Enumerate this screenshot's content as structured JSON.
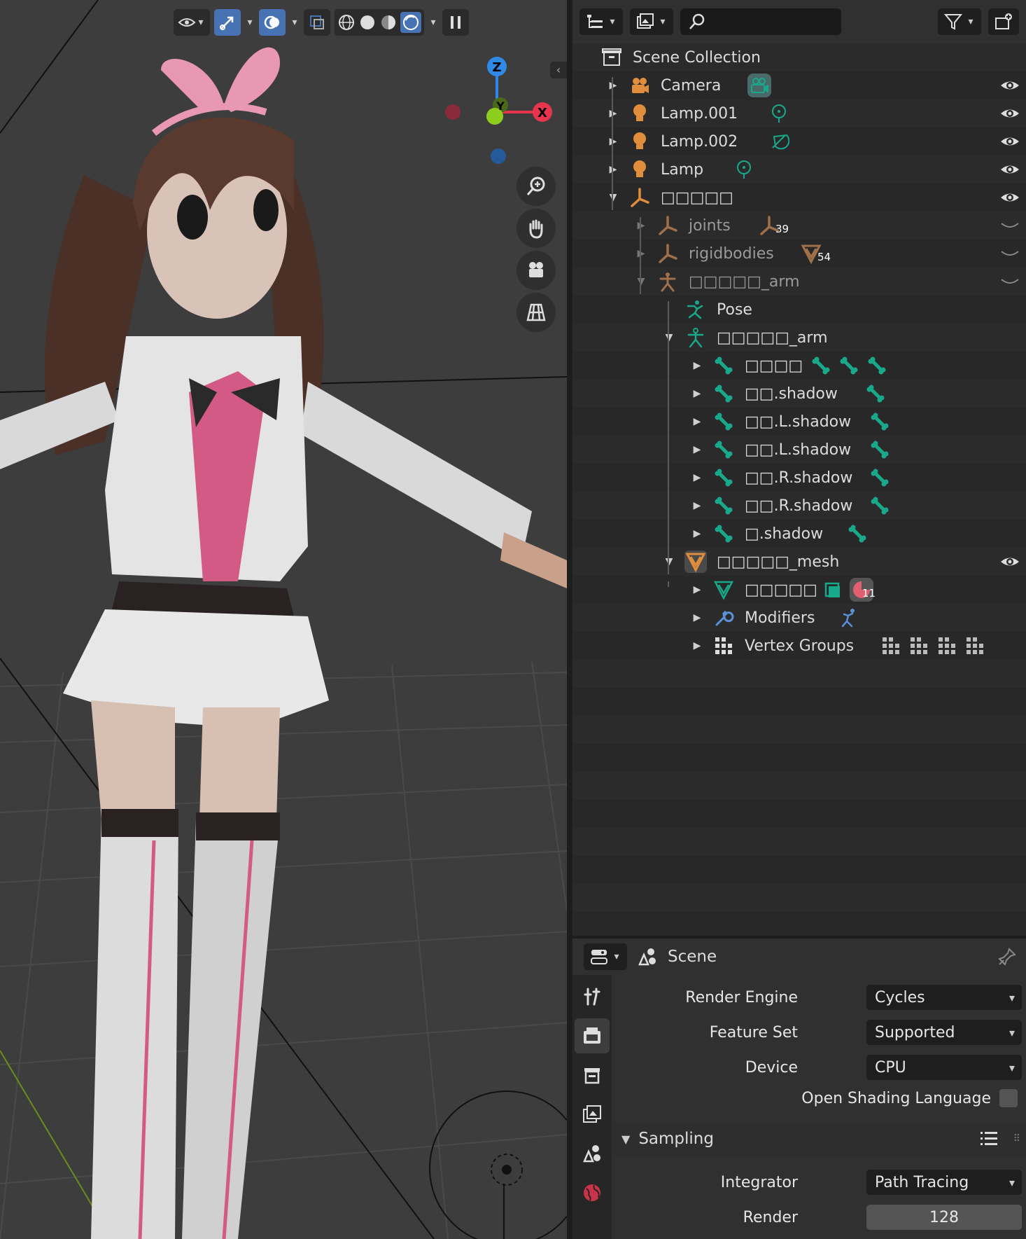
{
  "viewport": {
    "gizmo": {
      "x": "X",
      "y": "Y",
      "z": "Z"
    }
  },
  "outliner": {
    "search_placeholder": "",
    "rows": [
      {
        "label": "Scene Collection"
      },
      {
        "label": "Camera"
      },
      {
        "label": "Lamp.001"
      },
      {
        "label": "Lamp.002"
      },
      {
        "label": "Lamp"
      },
      {
        "label": "□□□□□"
      },
      {
        "label": "joints",
        "badge": "39"
      },
      {
        "label": "rigidbodies",
        "badge": "54"
      },
      {
        "label": "□□□□□_arm"
      },
      {
        "label": "Pose"
      },
      {
        "label": "□□□□□_arm"
      },
      {
        "label": "□□□□"
      },
      {
        "label": "□□.shadow"
      },
      {
        "label": "□□.L.shadow"
      },
      {
        "label": "□□.L.shadow"
      },
      {
        "label": "□□.R.shadow"
      },
      {
        "label": "□□.R.shadow"
      },
      {
        "label": "□.shadow"
      },
      {
        "label": "□□□□□_mesh"
      },
      {
        "label": "□□□□□",
        "badge": "11"
      },
      {
        "label": "Modifiers"
      },
      {
        "label": "Vertex Groups"
      }
    ]
  },
  "properties": {
    "context_title": "Scene",
    "render_engine": {
      "label": "Render Engine",
      "value": "Cycles"
    },
    "feature_set": {
      "label": "Feature Set",
      "value": "Supported"
    },
    "device": {
      "label": "Device",
      "value": "CPU"
    },
    "osl": {
      "label": "Open Shading Language"
    },
    "sampling": {
      "title": "Sampling"
    },
    "integrator": {
      "label": "Integrator",
      "value": "Path Tracing"
    },
    "render_samples": {
      "label": "Render",
      "value": "128"
    }
  },
  "colors": {
    "accent_blue": "#4772b3",
    "object_orange": "#e08d3c",
    "bone_green": "#18a98b",
    "axis_x": "#e8344c",
    "axis_y": "#8ccd1e",
    "axis_z": "#2e8ae6"
  }
}
